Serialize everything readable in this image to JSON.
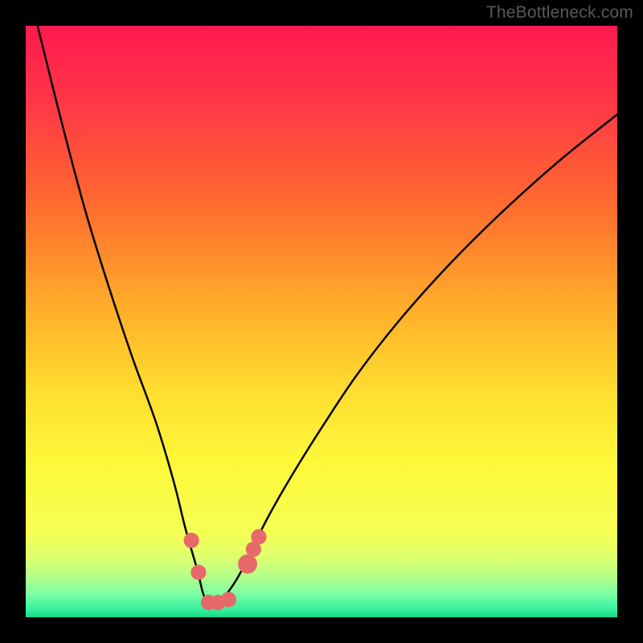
{
  "watermark": "TheBottleneck.com",
  "colors": {
    "frame_bg": "#000000",
    "gradient_top": "#ff1a4e",
    "gradient_mid_upper": "#ff7a28",
    "gradient_mid": "#ffe73a",
    "gradient_low1": "#f1ff4a",
    "gradient_low2": "#d4ff6a",
    "gradient_low3": "#88ff9a",
    "gradient_bottom": "#20e57a",
    "curve": "#000000",
    "marker_fill": "#e66a6a",
    "marker_stroke": "#c44f4f"
  },
  "chart_data": {
    "type": "line",
    "title": "",
    "xlabel": "",
    "ylabel": "",
    "xlim": [
      0,
      100
    ],
    "ylim": [
      0,
      100
    ],
    "grid": false,
    "legend": false,
    "note": "Single V-shaped curve on a red→green vertical gradient. Lower y = worse (red top), higher y toward bottom strip = better (green). Axis values are unlabeled; x and y are normalized 0–100.",
    "series": [
      {
        "name": "curve",
        "x": [
          2,
          6,
          10,
          14,
          18,
          22,
          25,
          27,
          29,
          30,
          31,
          32,
          34,
          36,
          38,
          41,
          45,
          50,
          56,
          63,
          71,
          80,
          90,
          100
        ],
        "y": [
          0,
          16,
          31,
          44,
          56,
          67,
          77,
          85,
          92,
          96,
          98,
          98,
          96,
          93,
          89,
          83,
          76,
          68,
          59,
          50,
          41,
          32,
          23,
          15
        ]
      }
    ],
    "markers": [
      {
        "x": 28.0,
        "y": 87.0,
        "r": 1.6
      },
      {
        "x": 29.2,
        "y": 92.4,
        "r": 1.6
      },
      {
        "x": 30.9,
        "y": 97.5,
        "r": 1.6
      },
      {
        "x": 32.5,
        "y": 97.5,
        "r": 1.6
      },
      {
        "x": 34.3,
        "y": 97.0,
        "r": 1.6
      },
      {
        "x": 37.5,
        "y": 91.0,
        "r": 2.0
      },
      {
        "x": 38.5,
        "y": 88.5,
        "r": 1.6
      },
      {
        "x": 39.4,
        "y": 86.4,
        "r": 1.6
      }
    ],
    "background_gradient_stops": [
      {
        "offset": 0.0,
        "color": "#ff1a4e"
      },
      {
        "offset": 0.12,
        "color": "#ff3448"
      },
      {
        "offset": 0.3,
        "color": "#ff6a2f"
      },
      {
        "offset": 0.48,
        "color": "#ffaf2a"
      },
      {
        "offset": 0.62,
        "color": "#ffde30"
      },
      {
        "offset": 0.74,
        "color": "#fff83a"
      },
      {
        "offset": 0.86,
        "color": "#f4ff55"
      },
      {
        "offset": 0.9,
        "color": "#ddff6f"
      },
      {
        "offset": 0.93,
        "color": "#b6ff88"
      },
      {
        "offset": 0.96,
        "color": "#7effa3"
      },
      {
        "offset": 0.985,
        "color": "#3af2a0"
      },
      {
        "offset": 1.0,
        "color": "#16d987"
      }
    ]
  }
}
